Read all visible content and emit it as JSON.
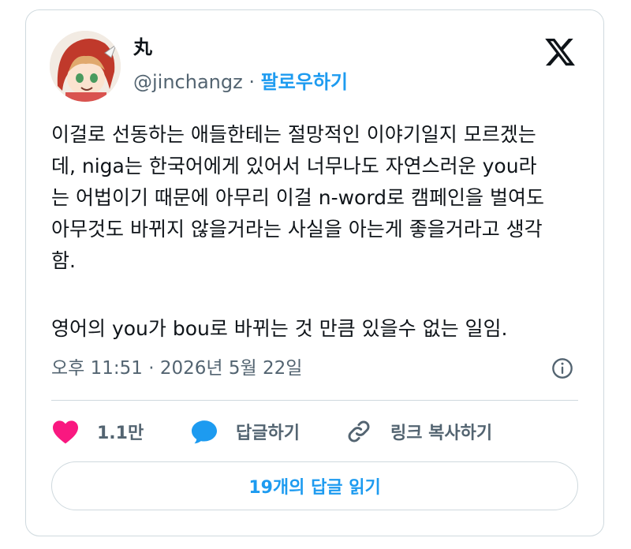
{
  "author": {
    "name": "丸",
    "handle": "@jinchangz",
    "separator": " · ",
    "follow_label": "팔로우하기"
  },
  "tweet": {
    "text_para1": "이걸로 선동하는 애들한테는 절망적인 이야기일지 모르겠는\n데, niga는 한국어에게 있어서 너무나도 자연스러운 you라\n는 어법이기 때문에 아무리 이걸 n-word로 캠페인을 벌여도\n아무것도 바뀌지 않을거라는 사실을 아는게 좋을거라고 생각\n함.",
    "text_para2": "영어의 you가 bou로 바뀌는 것 만큼 있을수 없는 일임.",
    "timestamp": "오후 11:51 · 2026년 5월 22일"
  },
  "actions": {
    "like_count": "1.1만",
    "reply_label": "답글하기",
    "copy_link_label": "링크 복사하기",
    "read_replies_label": "19개의 답글 읽기"
  },
  "icons": {
    "like": "heart-icon",
    "reply": "speech-bubble-icon",
    "copy_link": "link-icon",
    "info": "info-icon",
    "brand": "x-logo-icon"
  },
  "colors": {
    "accent": "#1d9bf0",
    "like": "#f91880",
    "muted_text": "#536471",
    "border": "#cfd9de"
  }
}
